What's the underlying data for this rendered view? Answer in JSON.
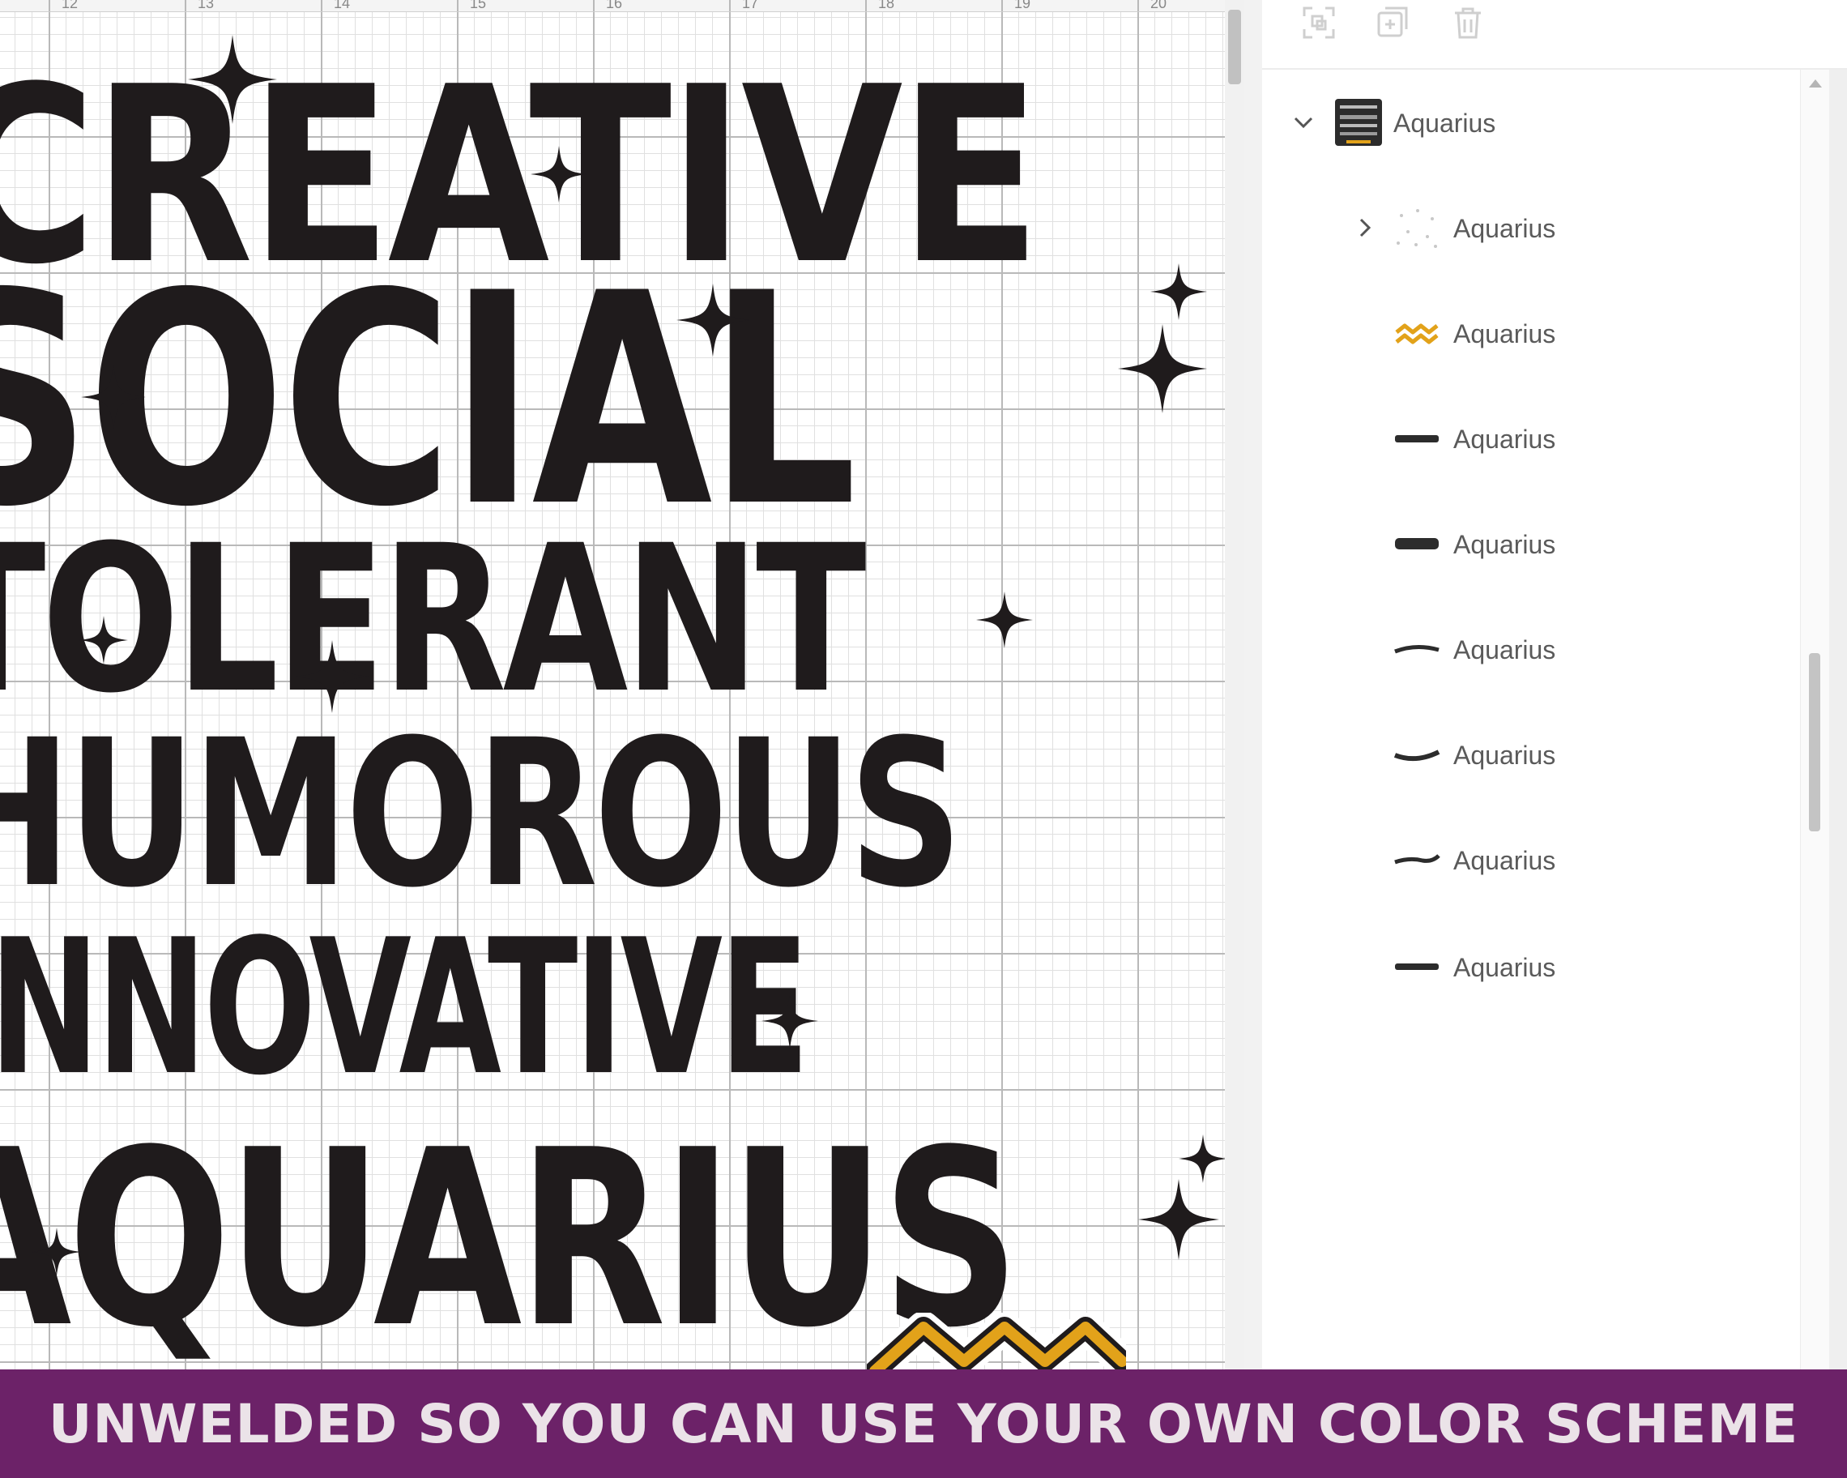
{
  "ruler": {
    "ticks": [
      "12",
      "13",
      "14",
      "15",
      "16",
      "17",
      "18",
      "19",
      "20"
    ]
  },
  "artwork": {
    "words": [
      "CREATIVE",
      "SOCIAL",
      "TOLERANT",
      "HUMOROUS",
      "INNOVATIVE",
      "AQUARIUS"
    ],
    "ink_color": "#1f1b1c",
    "accent_color": "#e2a21a"
  },
  "toolbar": {
    "icons": [
      "group-icon",
      "duplicate-icon",
      "delete-icon"
    ]
  },
  "layers": {
    "group": {
      "label": "Aquarius",
      "expanded": true
    },
    "items": [
      {
        "label": "Aquarius",
        "thumb": "stars",
        "has_children": true
      },
      {
        "label": "Aquarius",
        "thumb": "aquarius-symbol"
      },
      {
        "label": "Aquarius",
        "thumb": "creative"
      },
      {
        "label": "Aquarius",
        "thumb": "social"
      },
      {
        "label": "Aquarius",
        "thumb": "innovative"
      },
      {
        "label": "Aquarius",
        "thumb": "humorous"
      },
      {
        "label": "Aquarius",
        "thumb": "tolerant"
      },
      {
        "label": "Aquarius",
        "thumb": "aquarius-word"
      }
    ]
  },
  "banner": {
    "text": "UNWELDED SO YOU CAN USE YOUR OWN COLOR SCHEME",
    "color": "#6c2268"
  }
}
